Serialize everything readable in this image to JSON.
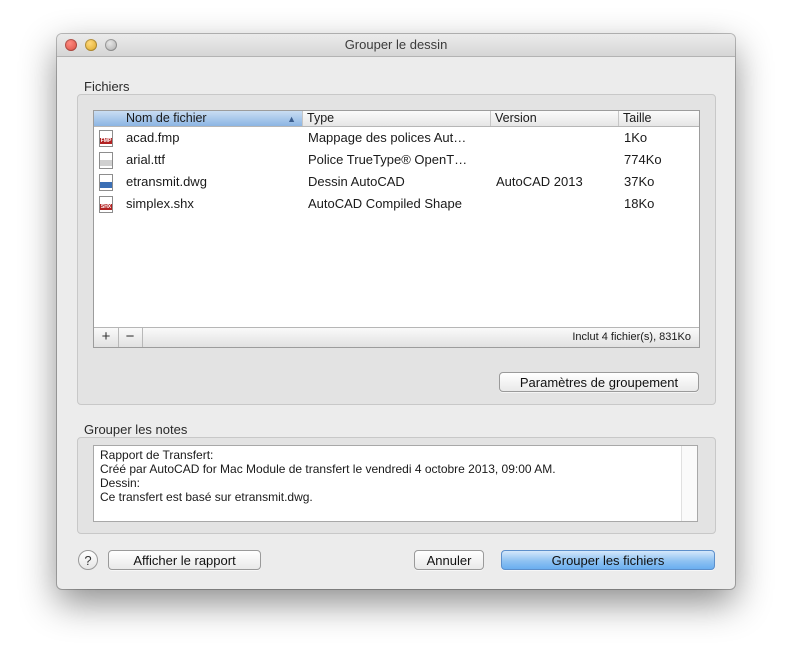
{
  "window": {
    "title": "Grouper le dessin"
  },
  "files_section": {
    "label": "Fichiers",
    "columns": [
      "Nom de fichier",
      "Type",
      "Version",
      "Taille"
    ],
    "rows": [
      {
        "icon": "fmp-file-icon",
        "icon_label": "FMP",
        "icon_color": "#b22222",
        "name": "acad.fmp",
        "type": "Mappage des polices Aut…",
        "version": "",
        "size": "1Ko"
      },
      {
        "icon": "ttf-file-icon",
        "icon_label": "",
        "icon_color": "#d0d0d0",
        "name": "arial.ttf",
        "type": " Police TrueType® OpenT…",
        "version": "",
        "size": "774Ko"
      },
      {
        "icon": "dwg-file-icon",
        "icon_label": "",
        "icon_color": "#3b6fb5",
        "name": "etransmit.dwg",
        "type": "Dessin AutoCAD",
        "version": "AutoCAD 2013",
        "size": "37Ko"
      },
      {
        "icon": "shx-file-icon",
        "icon_label": "SHX",
        "icon_color": "#b22222",
        "name": "simplex.shx",
        "type": "AutoCAD Compiled Shape",
        "version": "",
        "size": "18Ko"
      }
    ],
    "add_label": "+",
    "remove_label": "−",
    "status": "Inclut 4 fichier(s), 831Ko",
    "settings_button": "Paramètres de groupement"
  },
  "notes_section": {
    "label": "Grouper les notes",
    "lines": [
      "Rapport de Transfert:",
      "Créé par AutoCAD for Mac Module de transfert le vendredi 4 octobre 2013, 09:00 AM.",
      "",
      "Dessin:",
      "Ce transfert est basé sur etransmit.dwg."
    ]
  },
  "footer": {
    "help_label": "?",
    "report_button": "Afficher le rapport",
    "cancel_button": "Annuler",
    "group_button": "Grouper les fichiers"
  }
}
